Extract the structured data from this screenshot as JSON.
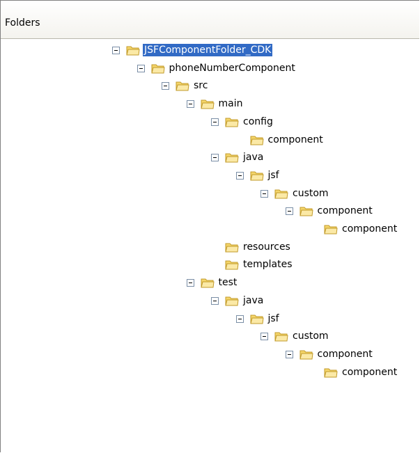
{
  "header": {
    "title": "Folders"
  },
  "tree": [
    {
      "label": "JSFComponentFolder_CDK",
      "level": 0,
      "expandable": true,
      "selected": true
    },
    {
      "label": "phoneNumberComponent",
      "level": 1,
      "expandable": true,
      "selected": false
    },
    {
      "label": "src",
      "level": 2,
      "expandable": true,
      "selected": false
    },
    {
      "label": "main",
      "level": 3,
      "expandable": true,
      "selected": false
    },
    {
      "label": "config",
      "level": 4,
      "expandable": true,
      "selected": false
    },
    {
      "label": "component",
      "level": 5,
      "expandable": false,
      "selected": false
    },
    {
      "label": "java",
      "level": 4,
      "expandable": true,
      "selected": false
    },
    {
      "label": "jsf",
      "level": 5,
      "expandable": true,
      "selected": false
    },
    {
      "label": "custom",
      "level": 6,
      "expandable": true,
      "selected": false
    },
    {
      "label": "component",
      "level": 7,
      "expandable": true,
      "selected": false
    },
    {
      "label": "component",
      "level": 8,
      "expandable": false,
      "selected": false
    },
    {
      "label": "resources",
      "level": 4,
      "expandable": false,
      "selected": false
    },
    {
      "label": "templates",
      "level": 4,
      "expandable": false,
      "selected": false
    },
    {
      "label": "test",
      "level": 3,
      "expandable": true,
      "selected": false
    },
    {
      "label": "java",
      "level": 4,
      "expandable": true,
      "selected": false
    },
    {
      "label": "jsf",
      "level": 5,
      "expandable": true,
      "selected": false
    },
    {
      "label": "custom",
      "level": 6,
      "expandable": true,
      "selected": false
    },
    {
      "label": "component",
      "level": 7,
      "expandable": true,
      "selected": false
    },
    {
      "label": "component",
      "level": 8,
      "expandable": false,
      "selected": false
    }
  ],
  "colors": {
    "selection": "#316ac5",
    "folder": "#f5d66b",
    "folder_outline": "#c19a2a"
  }
}
